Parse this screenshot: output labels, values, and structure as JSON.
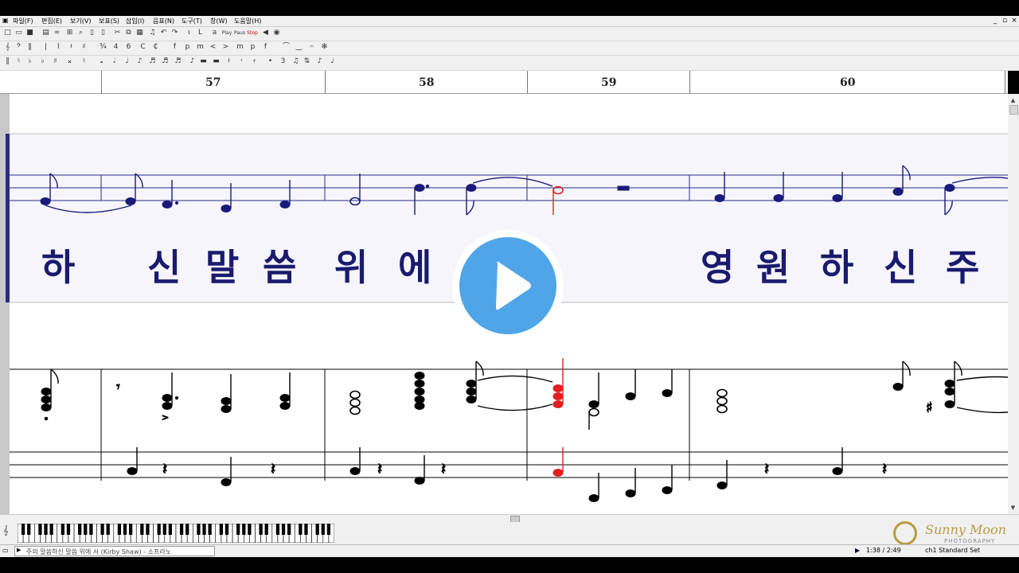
{
  "menu": [
    "파일(F)",
    "편집(E)",
    "보기(V)",
    "보표(S)",
    "삽입(I)",
    "음표(N)",
    "도구(T)",
    "창(W)",
    "도움말(H)"
  ],
  "toolbar": {
    "play_label": "Play",
    "pause_label": "Paus",
    "stop_label": "Stop"
  },
  "measures": [
    "57",
    "58",
    "59",
    "60"
  ],
  "lyrics": [
    "하",
    "신",
    "말",
    "씀",
    "위",
    "에",
    "영",
    "원",
    "하",
    "신",
    "주"
  ],
  "status": {
    "song_title": "주의 말씀하신 말씀 위에 서 (Kirby Shaw) - 소프라노",
    "time": "1:38 / 2:49",
    "channel": "ch1 Standard Set"
  },
  "logo": {
    "name": "Sunny Moon",
    "sub": "PHOTOGRAPHY"
  },
  "colors": {
    "melody": "#1a1a7a",
    "lyric": "#1a1a6e",
    "cursor": "#e02020",
    "play_blue": "#4fa5e8"
  }
}
